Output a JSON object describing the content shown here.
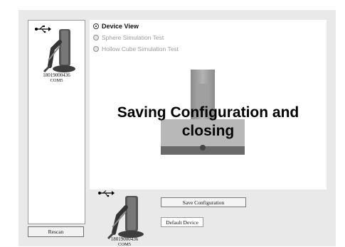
{
  "device_list": {
    "items": [
      {
        "serial": "18019000436",
        "port": "COM5",
        "icon": "usb-icon"
      }
    ],
    "rescan_label": "Rescan"
  },
  "views": {
    "options": [
      {
        "label": "Device View",
        "selected": true,
        "enabled": true
      },
      {
        "label": "Sphere Simulation Test",
        "selected": false,
        "enabled": false
      },
      {
        "label": "Hollow Cube Simulation Test",
        "selected": false,
        "enabled": false
      }
    ]
  },
  "overlay": {
    "line1": "Saving Configuration and",
    "line2": "closing"
  },
  "selected_device": {
    "serial": "18019000436",
    "port": "COM5",
    "icon": "usb-icon"
  },
  "actions": {
    "save_label": "Save Configuration",
    "default_label": "Default Device"
  }
}
